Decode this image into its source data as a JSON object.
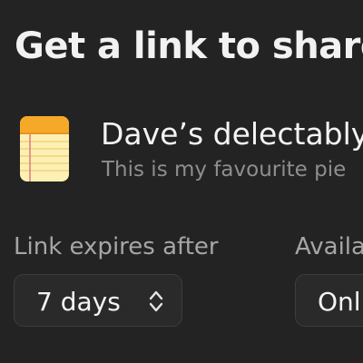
{
  "dialog": {
    "title": "Get a link to share"
  },
  "note": {
    "icon": "notes-app-icon",
    "name": "Dave’s delectably",
    "description": "This is my favourite pie"
  },
  "expiry": {
    "label": "Link expires after",
    "value": "7 days",
    "icon": "up-down-chevron-icon"
  },
  "availability": {
    "label": "Availa",
    "value": "Onl"
  },
  "colors": {
    "background": "#232323",
    "select_background": "#2a2a2a",
    "notes_icon_yellow": "#fbd34e",
    "notes_icon_orange": "#f5a623"
  }
}
